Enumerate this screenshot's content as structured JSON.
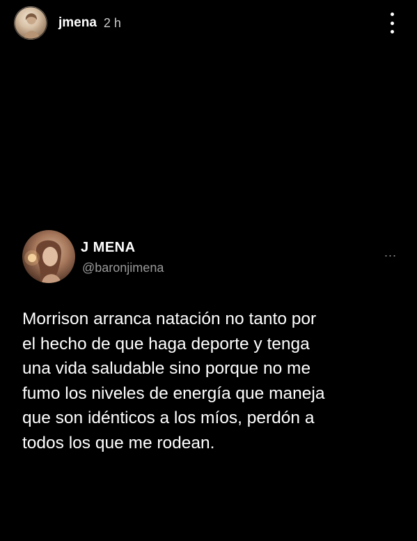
{
  "story": {
    "username": "jmena",
    "time": "2 h",
    "avatar_icon": "profile-photo",
    "more_icon": "vertical-ellipsis-icon"
  },
  "tweet": {
    "display_name": "J MENA",
    "handle": "@baronjimena",
    "more_label": "...",
    "avatar_icon": "profile-photo",
    "text_lines": [
      "Morrison arranca natación no tanto por",
      "el hecho de que haga deporte y tenga",
      "una vida saludable sino porque no me",
      "fumo los niveles de energía que maneja",
      "que son idénticos a los míos, perdón a",
      "todos los que me rodean."
    ]
  },
  "colors": {
    "background": "#000000",
    "text": "#ffffff",
    "secondary_text": "#9a9a9a"
  }
}
